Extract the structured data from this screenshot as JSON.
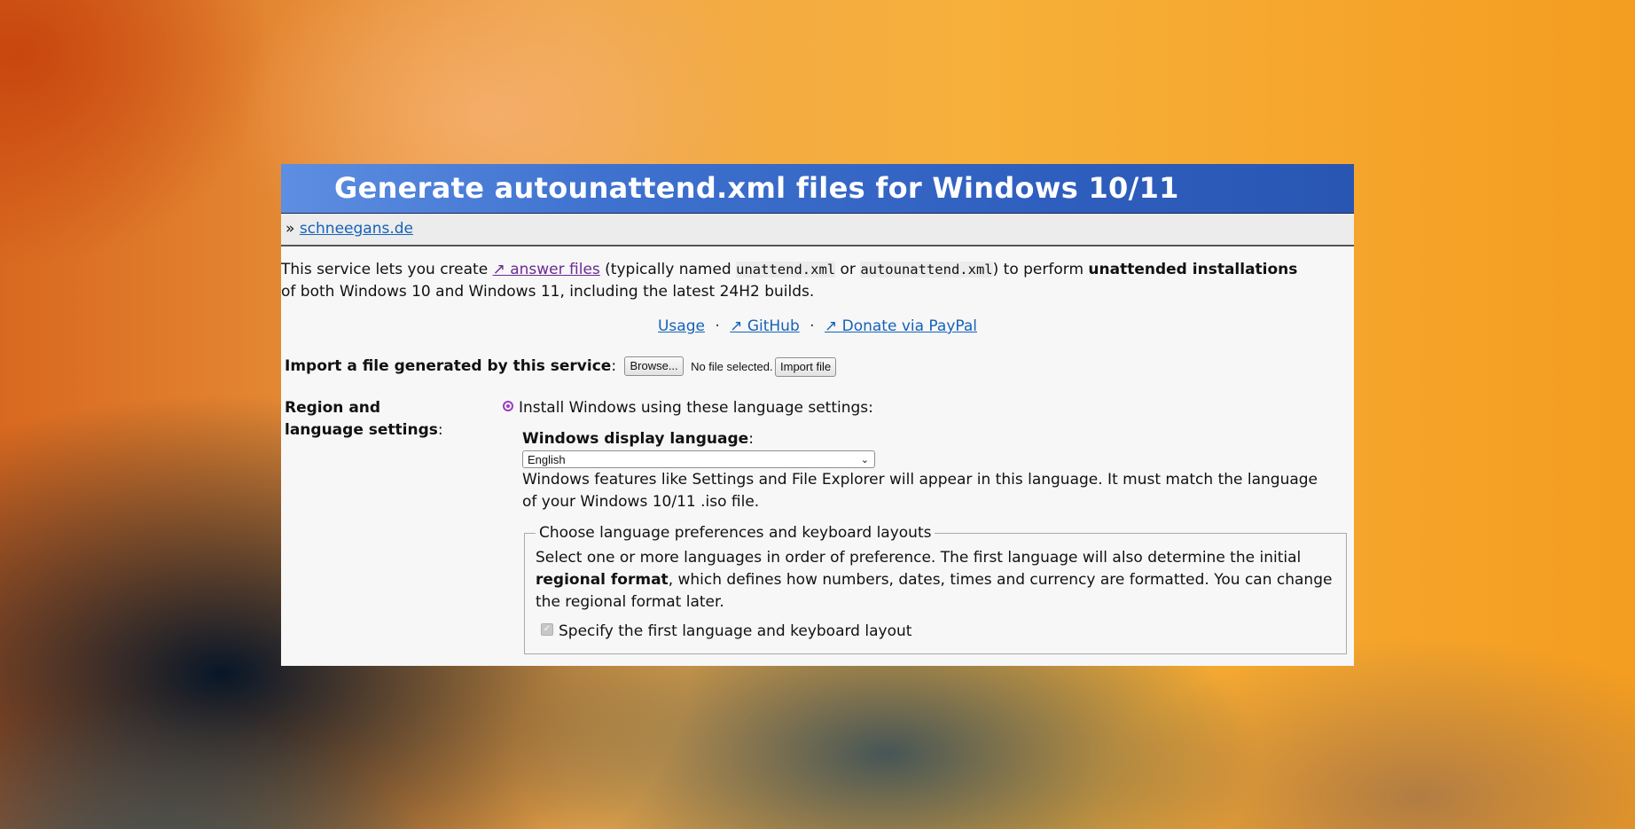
{
  "window": {
    "title": "Generate autounattend.xml files for Windows 10/11"
  },
  "breadcrumb": {
    "prefix": "»",
    "link": "schneegans.de"
  },
  "intro": {
    "t1": "This service lets you create ",
    "link": "↗ answer files",
    "t2": " (typically named ",
    "code1": "unattend.xml",
    "t3": " or ",
    "code2": "autounattend.xml",
    "t4": ") to perform ",
    "bold": "unattended installations",
    "t5": " of both Windows 10 and Windows 11, including the latest 24H2 builds."
  },
  "links": {
    "usage": "Usage",
    "github": "↗ GitHub",
    "donate": "↗ Donate via PayPal",
    "separator": "·"
  },
  "import": {
    "label": "Import a file generated by this service",
    "colon": ":",
    "browse": "Browse...",
    "no_file": "No file selected.",
    "import_button": "Import file"
  },
  "region": {
    "label": "Region and language settings",
    "colon": ":",
    "radio_label": "Install Windows using these language settings:",
    "display_language_label": "Windows display language",
    "display_language_colon": ":",
    "display_language_value": "English",
    "display_language_desc": "Windows features like Settings and File Explorer will appear in this language. It must match the language of your Windows 10/11 .iso file.",
    "fieldset_legend": "Choose language preferences and keyboard layouts",
    "fs_t1": "Select one or more languages in order of preference. The first language will also determine the initial ",
    "fs_bold": "regional format",
    "fs_t2": ", which defines how numbers, dates, times and currency are formatted. You can change the regional format later.",
    "first_language_checkbox": "Specify the first language and keyboard layout"
  },
  "colors": {
    "title_bar": "#2f5fbf",
    "link": "#1662b8",
    "visited_link": "#6a2c91",
    "radio_accent": "#9d3cc2"
  }
}
